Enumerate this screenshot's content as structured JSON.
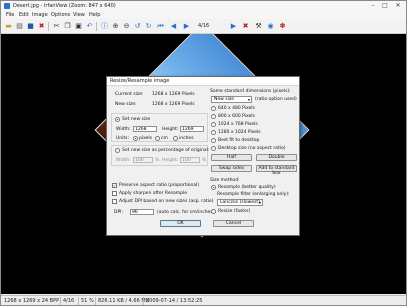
{
  "window": {
    "title": "Desert.jpg - IrfanView (Zoom: 847 x 640)",
    "minimize": "–",
    "maximize": "□",
    "close": "✕"
  },
  "menu": [
    "File",
    "Edit",
    "Image",
    "Options",
    "View",
    "Help"
  ],
  "toolbar": {
    "counter": "4/16"
  },
  "status": {
    "dims": "1268 x 1269 x 24 BPP",
    "index": "4/16",
    "zoom": "51 %",
    "size": "826.11 KB / 4.66 MB",
    "date": "2009-07-14 / 13:52:25"
  },
  "dialog": {
    "title": "Resize/Resample image",
    "current_size_label": "Current size:",
    "current_size_value": "1268 x 1269  Pixels",
    "new_size_label": "New size:",
    "new_size_value": "1268 x 1269  Pixels",
    "set_new_size_label": "Set new size",
    "width_label": "Width:",
    "width_value": "1268",
    "height_label": "Height:",
    "height_value": "1269",
    "units_label": "Units:",
    "unit_pixels": "pixels",
    "unit_cm": "cm",
    "unit_inches": "inches",
    "percentage_label": "Set new size as percentage of original:",
    "pct_width_label": "Width:",
    "pct_width_value": "100",
    "pct_height_label": "Height:",
    "pct_height_value": "100",
    "pct_unit": "%",
    "preserve_label": "Preserve aspect ratio (proportional)",
    "sharpen_label": "Apply sharpen after Resample",
    "adjust_dpi_label": "Adjust DPI based on new sizes (asp. ratio)",
    "dpi_label": "DPI:",
    "dpi_value": "96",
    "dpi_note": "(auto calc. for cm/inches)",
    "ok": "OK",
    "cancel": "Cancel",
    "std_dims_label": "Some standard dimensions (pixels):",
    "std_select_value": "New size",
    "ratio_note": "(ratio option used)",
    "options": [
      "640 x 480 Pixels",
      "800 x 600 Pixels",
      "1024 x 768 Pixels",
      "1280 x 1024 Pixels",
      "Best fit to desktop",
      "Desktop size (no aspect ratio)"
    ],
    "half": "Half",
    "double": "Double",
    "swap_sides": "Swap sides",
    "add_standard": "Add to standard box",
    "size_method_label": "Size method:",
    "resample_label": "Resample (better quality)",
    "filter_label": "Resample filter (enlarging only):",
    "filter_value": "Lanczos (slowest)",
    "resize_label": "Resize (faster)"
  }
}
